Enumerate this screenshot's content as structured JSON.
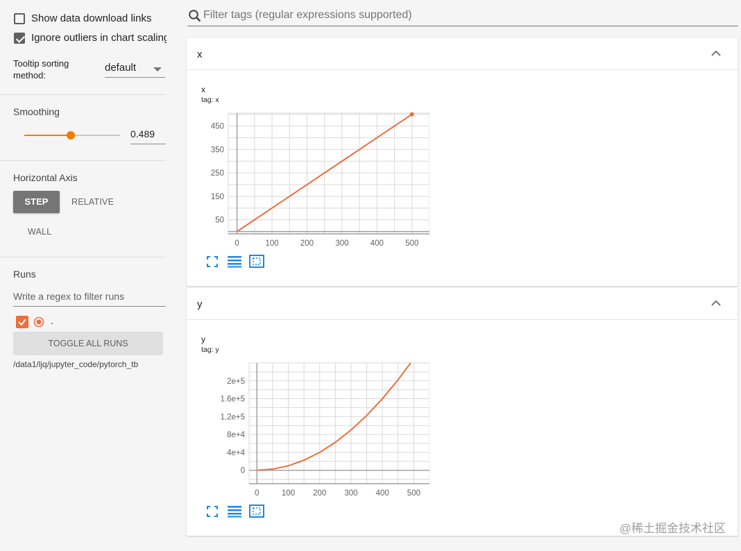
{
  "sidebar": {
    "show_download_label": "Show data download links",
    "show_download_checked": false,
    "ignore_outliers_label": "Ignore outliers in chart scaling",
    "ignore_outliers_checked": true,
    "tooltip_sorting_label": "Tooltip sorting method:",
    "tooltip_sorting_value": "default",
    "smoothing_title": "Smoothing",
    "smoothing_value": "0.489",
    "horizontal_axis_title": "Horizontal Axis",
    "axis_buttons": [
      "STEP",
      "RELATIVE",
      "WALL"
    ],
    "runs_title": "Runs",
    "runs_filter_placeholder": "Write a regex to filter runs",
    "run_name": ".",
    "toggle_all_label": "TOGGLE ALL RUNS",
    "logdir": "/data1/ljq/jupyter_code/pytorch_tb"
  },
  "search": {
    "placeholder": "Filter tags (regular expressions supported)"
  },
  "colors": {
    "accent": "#f57c00",
    "series": "#ec6e3a",
    "grid": "#d9d9d9",
    "icon": "#1e88e5"
  },
  "cards": [
    {
      "title": "x",
      "chart_title": "x",
      "chart_tag": "tag: x"
    },
    {
      "title": "y",
      "chart_title": "y",
      "chart_tag": "tag: y"
    }
  ],
  "chart_data": [
    {
      "type": "line",
      "title": "x",
      "subtitle": "tag: x",
      "x": [
        0,
        100,
        200,
        300,
        400,
        500
      ],
      "y": [
        0,
        100,
        200,
        300,
        400,
        500
      ],
      "xticks": [
        "0",
        "100",
        "200",
        "300",
        "400",
        "500"
      ],
      "yticks": [
        "50",
        "150",
        "250",
        "350",
        "450"
      ],
      "xlim": [
        -25,
        550
      ],
      "ylim": [
        -10,
        505
      ],
      "grid": true
    },
    {
      "type": "line",
      "title": "y",
      "subtitle": "tag: y",
      "x": [
        0,
        50,
        100,
        150,
        200,
        250,
        300,
        350,
        400,
        450,
        490
      ],
      "y": [
        0,
        2500,
        10000,
        22500,
        40000,
        62500,
        90000,
        122500,
        160000,
        202500,
        240100
      ],
      "xticks": [
        "0",
        "100",
        "200",
        "300",
        "400",
        "500"
      ],
      "yticks": [
        "0",
        "4e+4",
        "8e+4",
        "1.2e+5",
        "1.6e+5",
        "2e+5"
      ],
      "xlim": [
        -25,
        550
      ],
      "ylim": [
        -30000,
        240000
      ],
      "grid": true
    }
  ],
  "watermark": "@稀土掘金技术社区"
}
